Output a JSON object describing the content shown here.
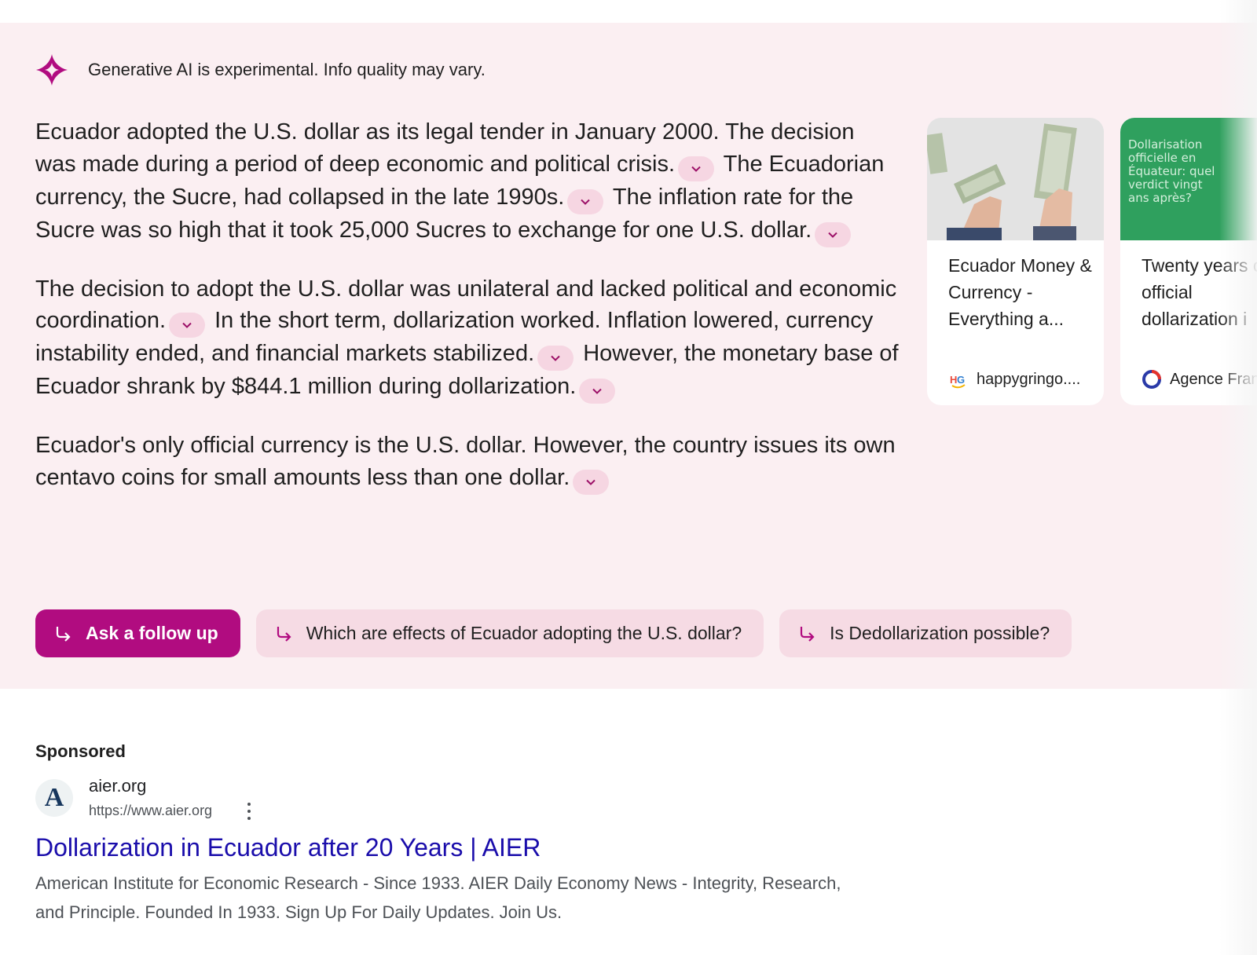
{
  "disclaimer": "Generative AI is experimental. Info quality may vary.",
  "answer": {
    "p1": [
      "Ecuador adopted the U.S. dollar as its legal tender in January 2000. The decision was made during a period of deep economic and political crisis.",
      "The Ecuadorian currency, the Sucre, had collapsed in the late 1990s.",
      "The inflation rate for the Sucre was so high that it took 25,000 Sucres to exchange for one U.S. dollar."
    ],
    "p2": [
      "The decision to adopt the U.S. dollar was unilateral and lacked political and economic coordination.",
      "In the short term, dollarization worked. Inflation lowered, currency instability ended, and financial markets stabilized.",
      "However, the monetary base of Ecuador shrank by $844.1 million during dollarization."
    ],
    "p3": [
      "Ecuador's only official currency is the U.S. dollar. However, the country issues its own centavo coins for small amounts less than one dollar."
    ]
  },
  "sources": [
    {
      "title": "Ecuador Money & Currency - Everything a...",
      "source": "happygringo....",
      "icon": "happygringo-logo-icon"
    },
    {
      "title": "Twenty years of official dollarization i",
      "source": "Agence Fran",
      "image_text": "Dollarisation officielle en Équateur: quel verdict vingt ans après?",
      "icon": "afp-logo-icon"
    }
  ],
  "followups": {
    "primary": "Ask a follow up",
    "suggestions": [
      "Which are effects of Ecuador adopting the U.S. dollar?",
      "Is Dedollarization possible?"
    ]
  },
  "ad": {
    "label": "Sponsored",
    "favicon_letter": "A",
    "site": "aier.org",
    "url": "https://www.aier.org",
    "title": "Dollarization in Ecuador after 20 Years | AIER",
    "description": "American Institute for Economic Research - Since 1933. AIER Daily Economy News - Integrity, Research, and Principle. Founded In 1933. Sign Up For Daily Updates. Join Us."
  },
  "colors": {
    "accent": "#b10c80",
    "panel": "#fbeff2",
    "chip": "#f6dbe4",
    "link": "#1a0dab"
  }
}
